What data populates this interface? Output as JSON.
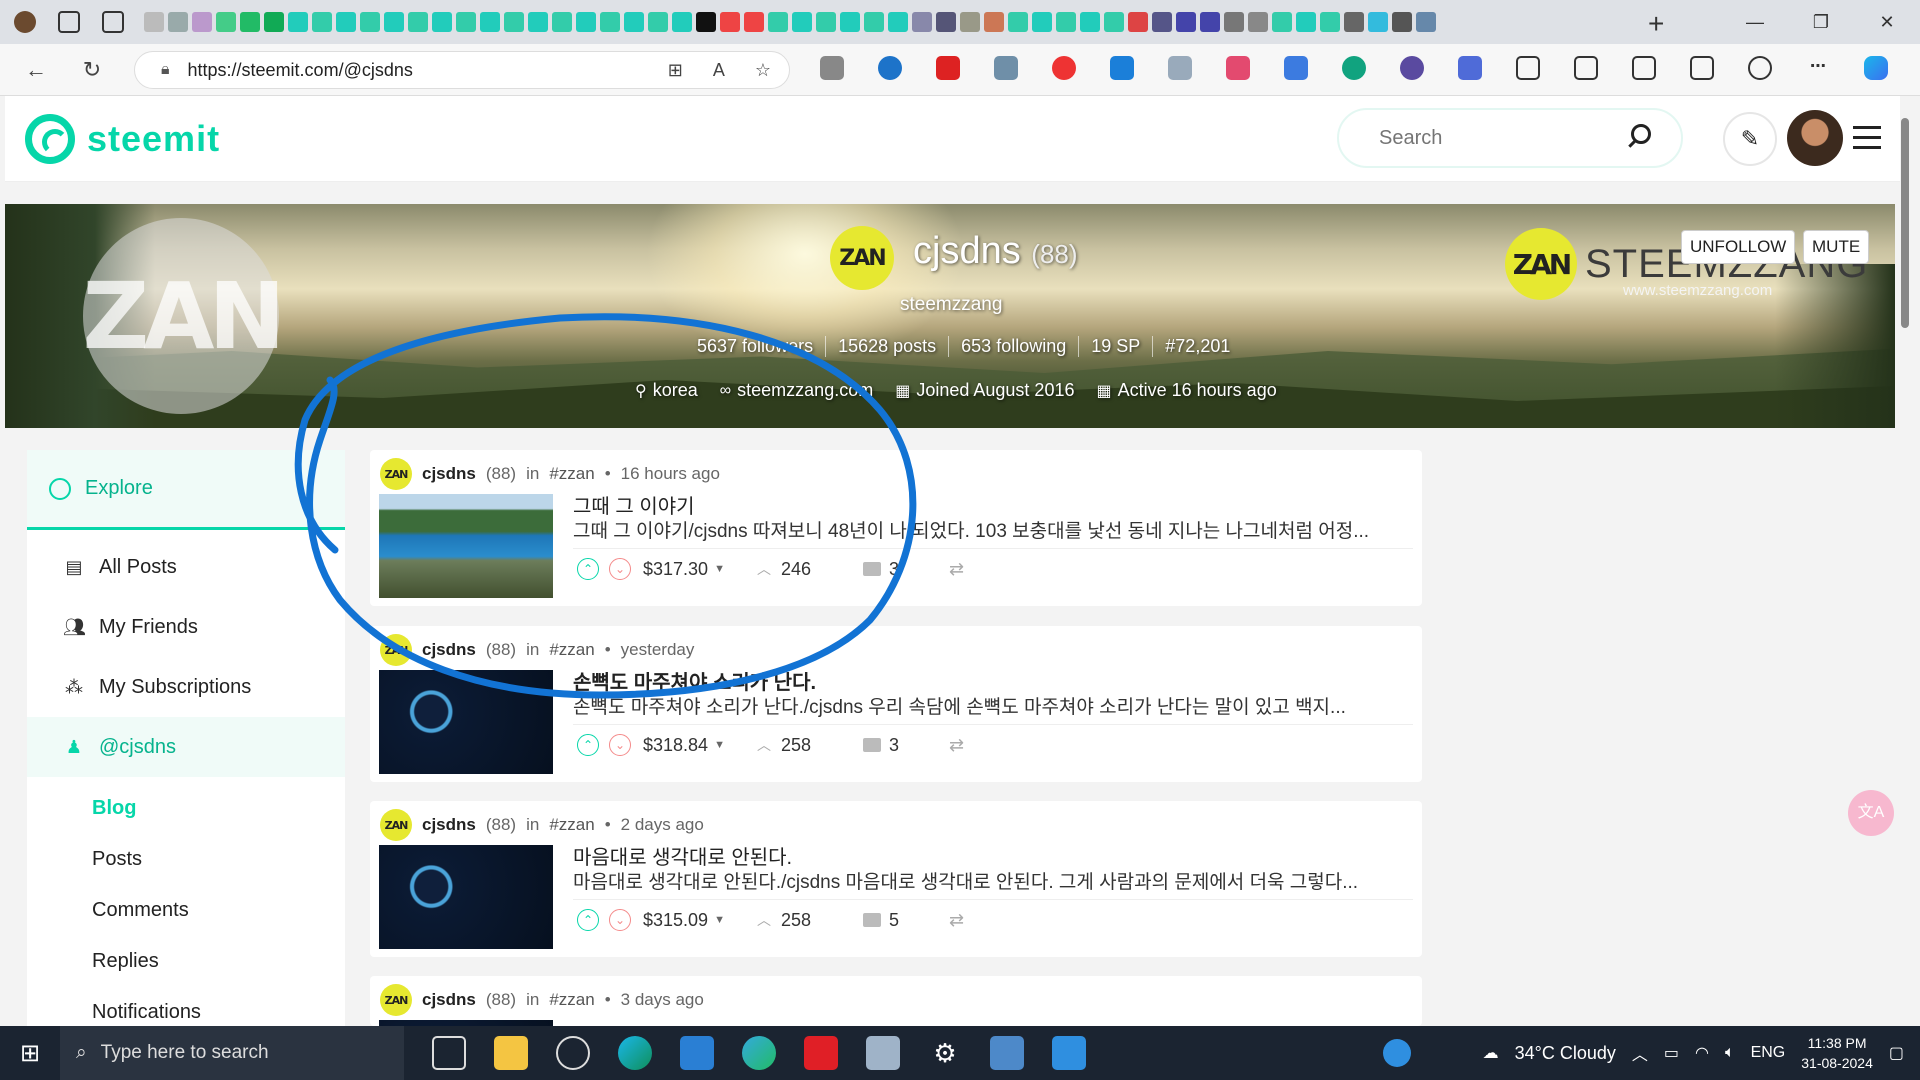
{
  "browser": {
    "url": "https://steemit.com/@cjsdns"
  },
  "header": {
    "logo_text": "steemit",
    "search_placeholder": "Search"
  },
  "profile": {
    "name": "cjsdns",
    "reputation": "(88)",
    "about": "steemzzang",
    "avatar_text": "ZAN",
    "followers": "5637 followers",
    "posts": "15628 posts",
    "following": "653 following",
    "sp": "19 SP",
    "rank": "#72,201",
    "location": "korea",
    "website": "steemzzang.com",
    "joined": "Joined August 2016",
    "active": "Active 16 hours ago",
    "brand_logo": "ZAN",
    "brand_text": "STEEMZZANG",
    "brand_url": "www.steemzzang.com",
    "unfollow_label": "UNFOLLOW",
    "mute_label": "MUTE"
  },
  "sidebar": {
    "explore": "Explore",
    "items": [
      {
        "label": "All Posts",
        "icon": "list-icon"
      },
      {
        "label": "My Friends",
        "icon": "friends-icon"
      },
      {
        "label": "My Subscriptions",
        "icon": "subscriptions-icon"
      },
      {
        "label": "@cjsdns",
        "icon": "user-icon"
      }
    ],
    "sub_items": [
      "Blog",
      "Posts",
      "Comments",
      "Replies",
      "Notifications"
    ]
  },
  "posts": [
    {
      "author": "cjsdns",
      "rep": "(88)",
      "community": "#zzan",
      "time": "16 hours ago",
      "title": "그때 그 이야기",
      "excerpt": "그때 그 이야기/cjsdns 따져보니 48년이 나 되었다. 103 보충대를 낯선 동네 지나는 나그네처럼 어정...",
      "payout": "$317.30",
      "votes": "246",
      "comments": "3"
    },
    {
      "author": "cjsdns",
      "rep": "(88)",
      "community": "#zzan",
      "time": "yesterday",
      "title": "손뼉도 마주쳐야 소리가 난다.",
      "excerpt": "손뼉도 마주쳐야 소리가 난다./cjsdns 우리 속담에 손뼉도 마주쳐야 소리가 난다는 말이 있고 백지...",
      "payout": "$318.84",
      "votes": "258",
      "comments": "3"
    },
    {
      "author": "cjsdns",
      "rep": "(88)",
      "community": "#zzan",
      "time": "2 days ago",
      "title": "마음대로 생각대로 안된다.",
      "excerpt": "마음대로 생각대로 안된다./cjsdns 마음대로 생각대로 안된다. 그게 사람과의 문제에서 더욱 그렇다...",
      "payout": "$315.09",
      "votes": "258",
      "comments": "5"
    },
    {
      "author": "cjsdns",
      "rep": "(88)",
      "community": "#zzan",
      "time": "3 days ago"
    }
  ],
  "taskbar": {
    "search_placeholder": "Type here to search",
    "weather": "34°C  Cloudy",
    "language": "ENG",
    "time": "11:38 PM",
    "date": "31-08-2024"
  },
  "colors": {
    "accent": "#06d6a9",
    "downvote": "#f48a8a",
    "annotation": "#1273d4"
  }
}
